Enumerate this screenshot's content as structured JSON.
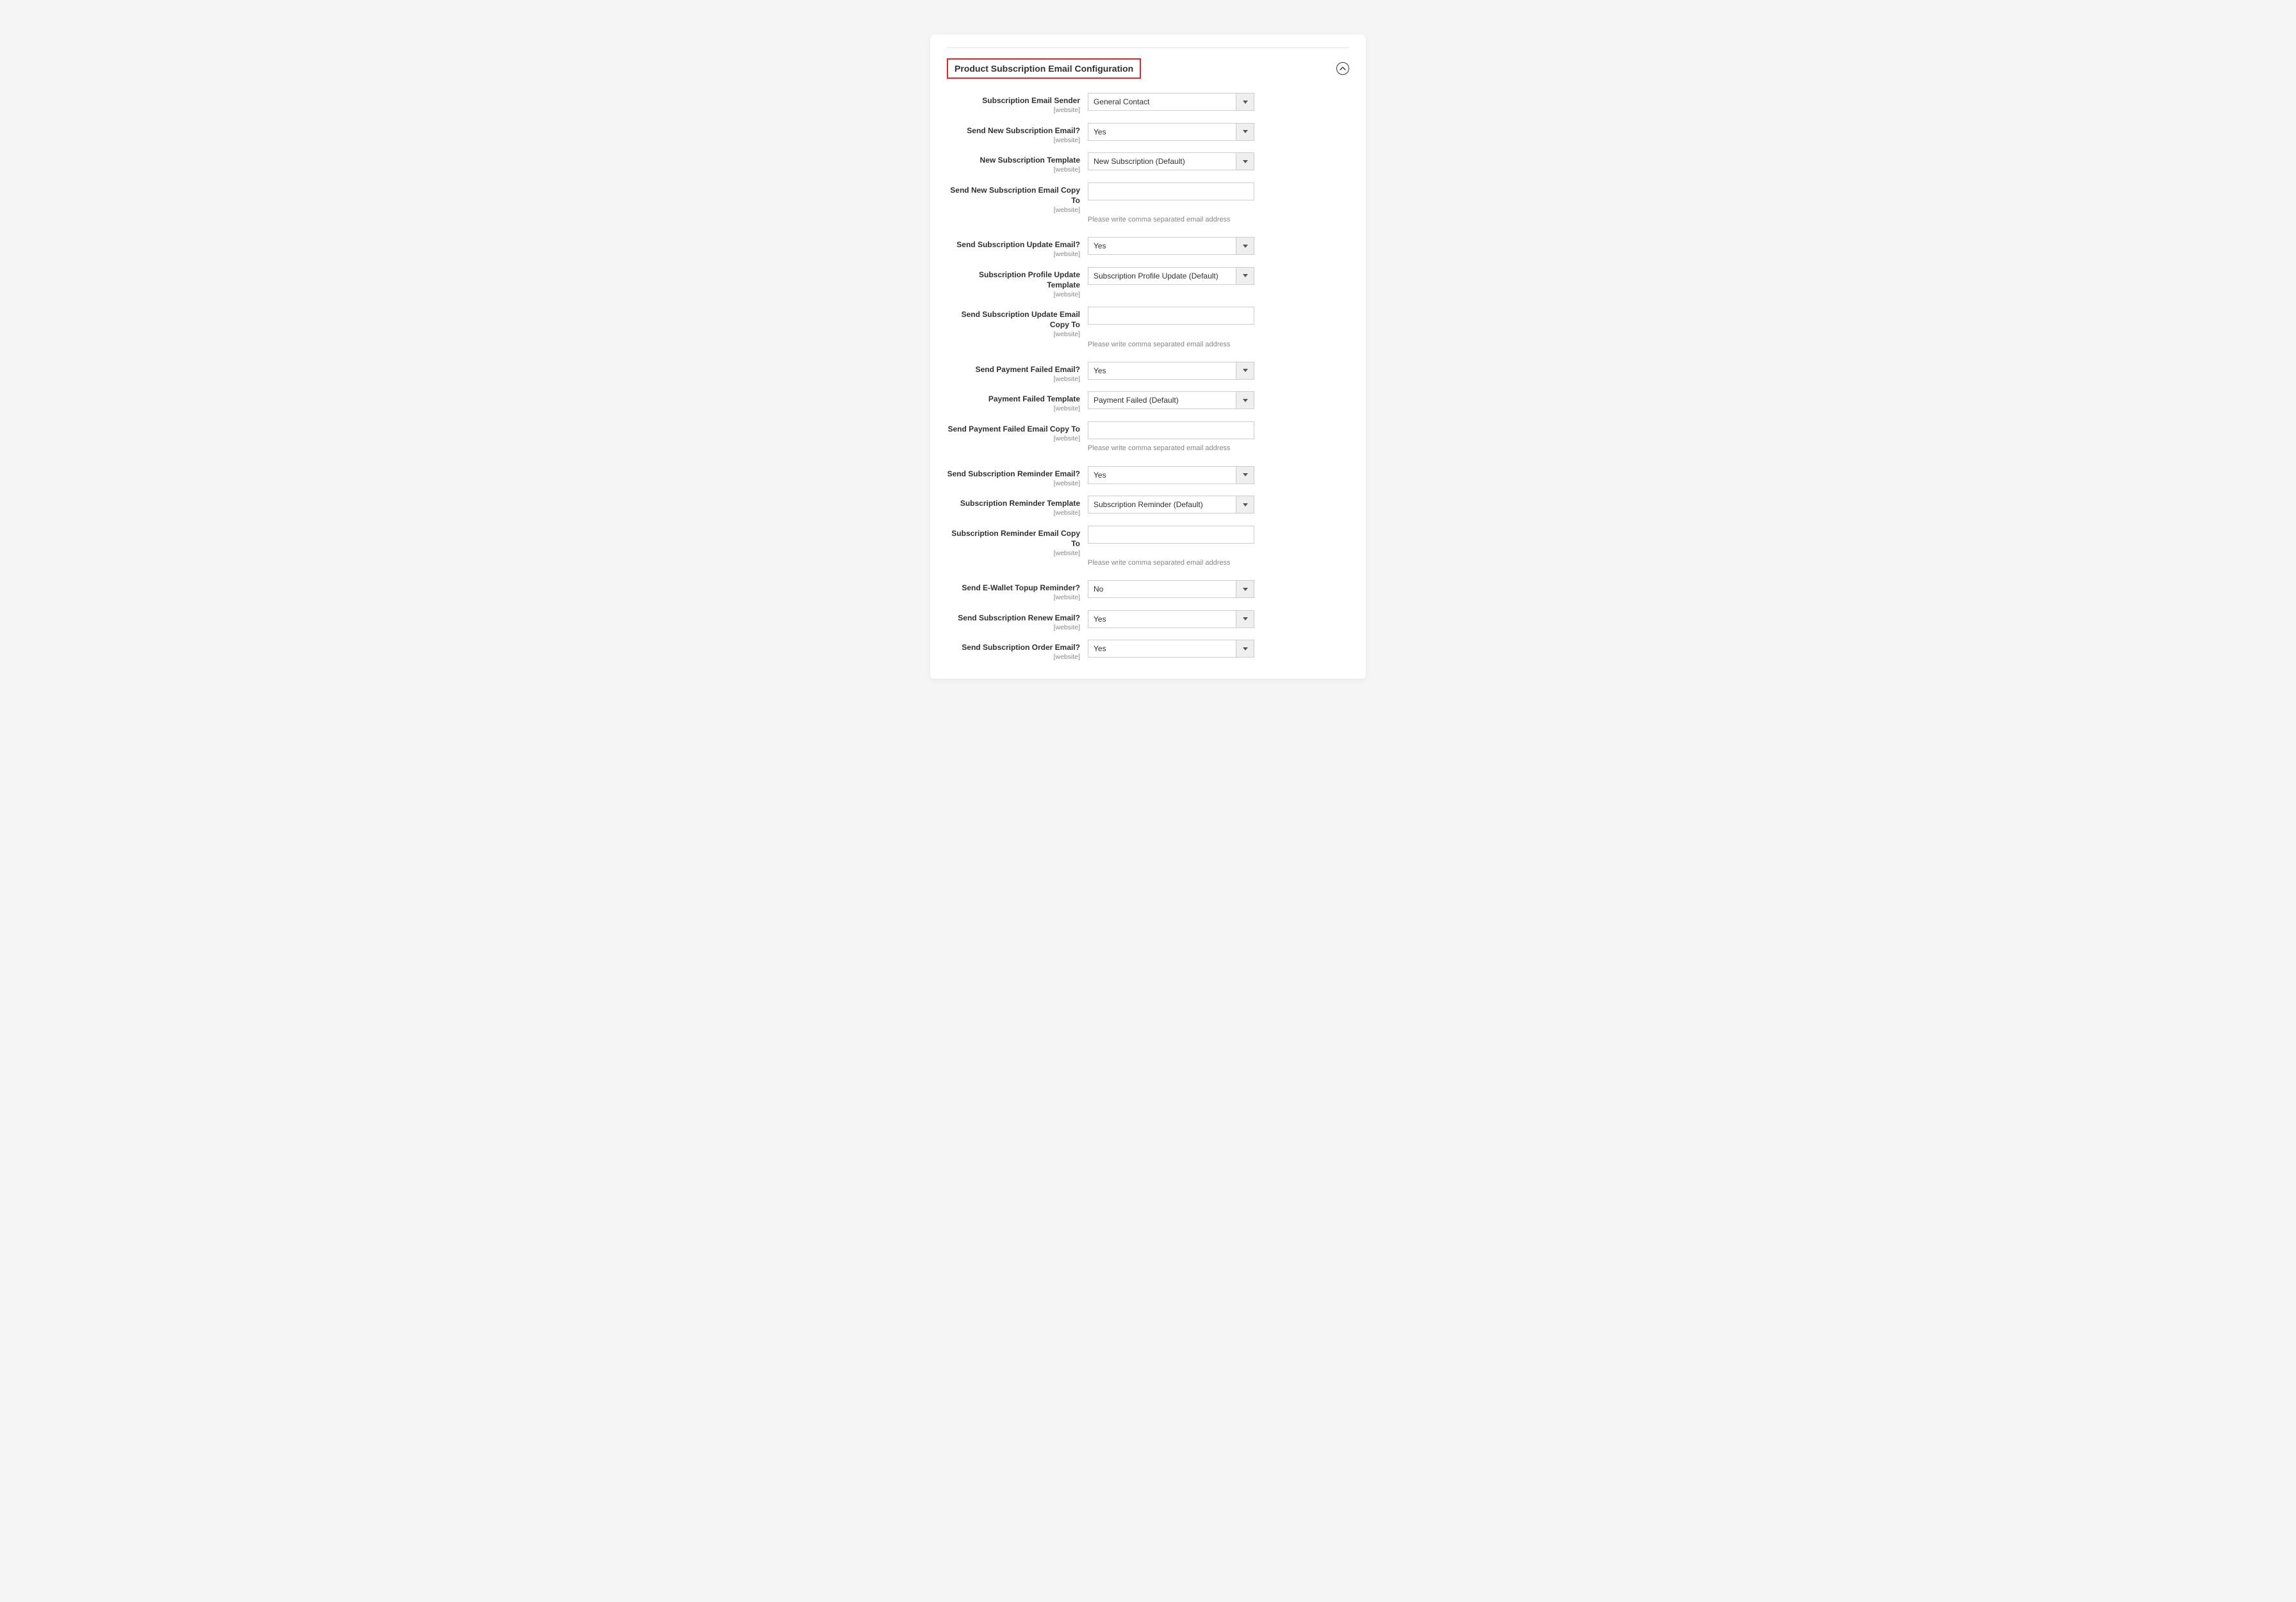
{
  "section": {
    "title": "Product Subscription Email Configuration"
  },
  "scope": "[website]",
  "hint_comma": "Please write comma separated email address",
  "fields": {
    "sender": {
      "label": "Subscription Email Sender",
      "value": "General Contact"
    },
    "send_new": {
      "label": "Send New Subscription Email?",
      "value": "Yes"
    },
    "template_new": {
      "label": "New Subscription Template",
      "value": "New Subscription (Default)"
    },
    "copy_new": {
      "label": "Send New Subscription Email Copy To",
      "value": ""
    },
    "send_update": {
      "label": "Send Subscription Update Email?",
      "value": "Yes"
    },
    "template_update": {
      "label": "Subscription Profile Update Template",
      "value": "Subscription Profile Update (Default)"
    },
    "copy_update": {
      "label": "Send Subscription Update Email Copy To",
      "value": ""
    },
    "send_failed": {
      "label": "Send Payment Failed Email?",
      "value": "Yes"
    },
    "template_failed": {
      "label": "Payment Failed Template",
      "value": "Payment Failed (Default)"
    },
    "copy_failed": {
      "label": "Send Payment Failed Email Copy To",
      "value": ""
    },
    "send_reminder": {
      "label": "Send Subscription Reminder Email?",
      "value": "Yes"
    },
    "template_reminder": {
      "label": "Subscription Reminder Template",
      "value": "Subscription Reminder (Default)"
    },
    "copy_reminder": {
      "label": "Subscription Reminder Email Copy To",
      "value": ""
    },
    "send_ewallet": {
      "label": "Send E-Wallet Topup Reminder?",
      "value": "No"
    },
    "send_renew": {
      "label": "Send Subscription Renew Email?",
      "value": "Yes"
    },
    "send_order": {
      "label": "Send Subscription Order Email?",
      "value": "Yes"
    }
  }
}
